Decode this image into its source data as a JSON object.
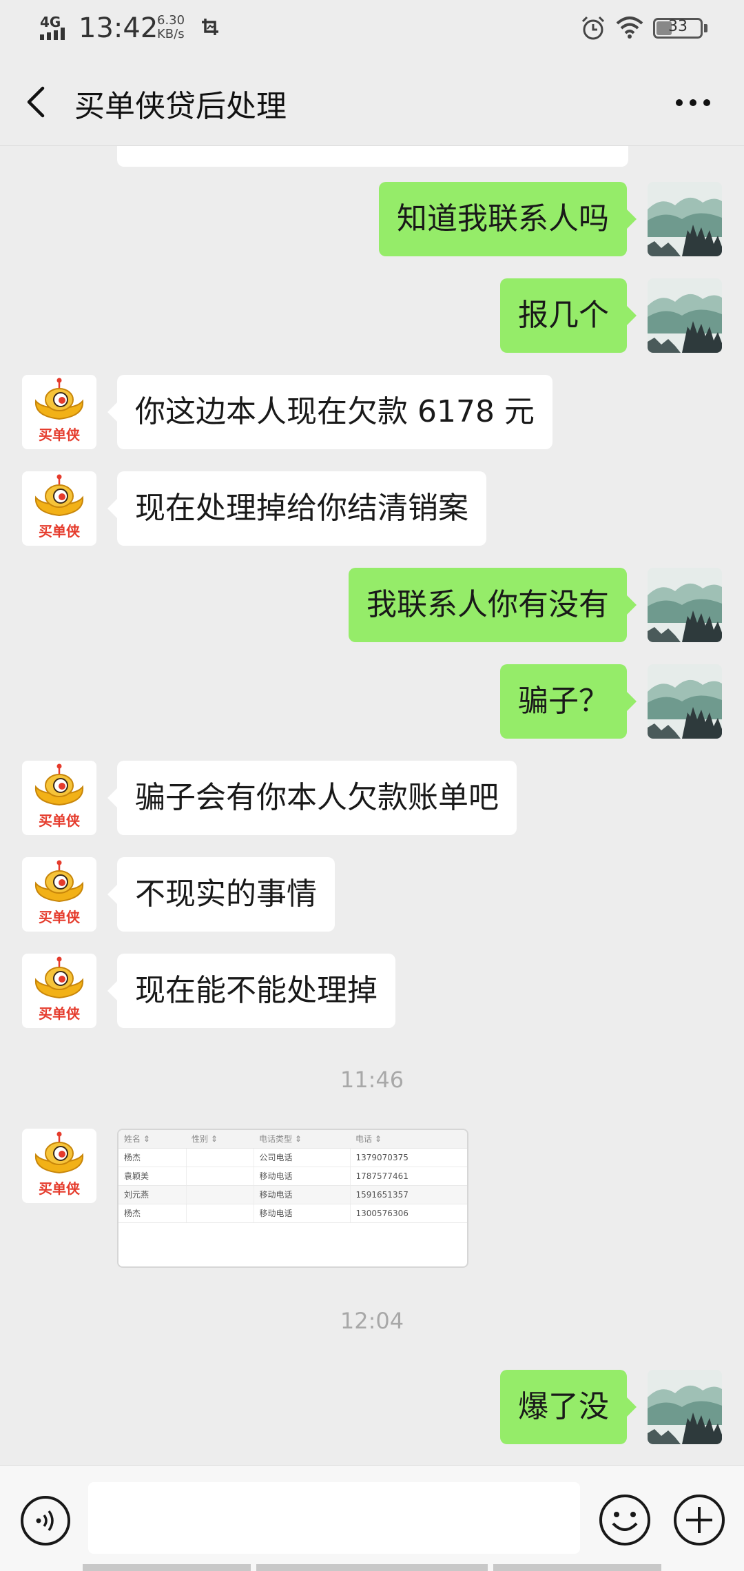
{
  "status_bar": {
    "network": "4G",
    "time": "13:42",
    "speed_value": "6.30",
    "speed_unit": "KB/s",
    "battery": "33",
    "battery_level": 0.33
  },
  "header": {
    "title": "买单侠贷后处理"
  },
  "colors": {
    "self_bubble": "#95ec69",
    "other_bubble": "#ffffff",
    "background": "#ededed",
    "brand_avatar": "#e8a21a"
  },
  "messages": [
    {
      "sender": "self",
      "text": "知道我联系人吗"
    },
    {
      "sender": "self",
      "text": "报几个"
    },
    {
      "sender": "other",
      "text": "你这边本人现在欠款 6178 元"
    },
    {
      "sender": "other",
      "text": "现在处理掉给你结清销案"
    },
    {
      "sender": "self",
      "text": "我联系人你有没有"
    },
    {
      "sender": "self",
      "text": "骗子？"
    },
    {
      "sender": "other",
      "text": "骗子会有你本人欠款账单吧"
    },
    {
      "sender": "other",
      "text": "不现实的事情"
    },
    {
      "sender": "other",
      "text": "现在能不能处理掉"
    },
    {
      "sender": "self",
      "text": "爆了没"
    }
  ],
  "timestamps": [
    "11:46",
    "12:04"
  ],
  "avatar_label": "买单侠",
  "shared_table": {
    "headers": [
      "姓名 ⇕",
      "性别 ⇕",
      "电话类型 ⇕",
      "电话 ⇕"
    ],
    "rows": [
      [
        "杨杰",
        "",
        "公司电话",
        "1379070375"
      ],
      [
        "袁颖美",
        "",
        "移动电话",
        "1787577461"
      ],
      [
        "刘元燕",
        "",
        "移动电话",
        "1591651357"
      ],
      [
        "杨杰",
        "",
        "移动电话",
        "1300576306"
      ]
    ]
  },
  "input": {
    "value": "",
    "placeholder": ""
  },
  "icons": {
    "back": "back-arrow-icon",
    "more": "more-dots-icon",
    "voice": "voice-icon",
    "emoji": "emoji-icon",
    "plus": "plus-icon",
    "alarm": "alarm-icon",
    "wifi": "wifi-icon",
    "signal": "signal-icon",
    "screenshot": "screenshot-icon"
  }
}
